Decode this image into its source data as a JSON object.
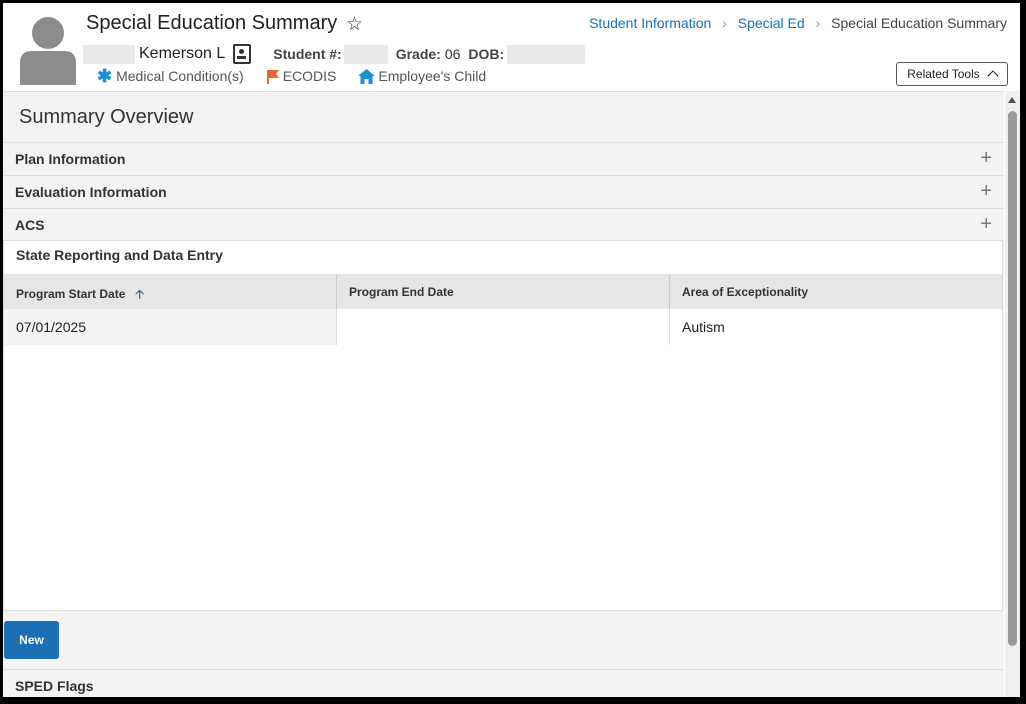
{
  "header": {
    "title": "Special Education Summary",
    "breadcrumbs": [
      "Student Information",
      "Special Ed",
      "Special Education Summary"
    ],
    "student_name": "Kemerson L",
    "student_num_label": "Student #:",
    "grade_label": "Grade:",
    "grade_value": "06",
    "dob_label": "DOB:",
    "flags": [
      {
        "label": "Medical Condition(s)",
        "icon": "asterisk-icon",
        "color": "#1a8fd6"
      },
      {
        "label": "ECODIS",
        "icon": "flag-icon",
        "color": "#e8692a"
      },
      {
        "label": "Employee's Child",
        "icon": "house-icon",
        "color": "#1a8fd6"
      }
    ],
    "related_tools_label": "Related Tools"
  },
  "main": {
    "section_title": "Summary Overview",
    "accordions": [
      "Plan Information",
      "Evaluation Information",
      "ACS"
    ],
    "panel_title": "State Reporting and Data Entry",
    "columns": [
      "Program Start Date",
      "Program End Date",
      "Area of Exceptionality"
    ],
    "rows": [
      [
        "07/01/2025",
        "",
        "Autism"
      ]
    ],
    "new_label": "New",
    "sped_flags_label": "SPED Flags"
  },
  "colors": {
    "accent": "#1a6fb5",
    "link": "#1a6fb5"
  }
}
